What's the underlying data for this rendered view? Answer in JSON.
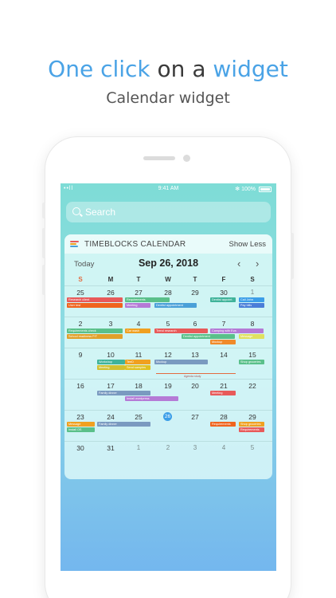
{
  "headline": {
    "part1": "One click",
    "part2": " on a ",
    "part3": "widget"
  },
  "subline": "Calendar widget",
  "status": {
    "signal": "••ll",
    "time": "9:41 AM",
    "battery": "✻ 100%"
  },
  "search": {
    "placeholder": "Search"
  },
  "widget": {
    "app_title": "TIMEBLOCKS CALENDAR",
    "show_less": "Show Less",
    "today": "Today",
    "month_title": "Sep 26, 2018",
    "prev": "‹",
    "next": "›",
    "weekdays": [
      "S",
      "M",
      "T",
      "W",
      "T",
      "F",
      "S"
    ],
    "weeks": [
      [
        "25",
        "26",
        "27",
        "28",
        "29",
        "30",
        "1"
      ],
      [
        "2",
        "3",
        "4",
        "5",
        "6",
        "7",
        "8"
      ],
      [
        "9",
        "10",
        "11",
        "12",
        "13",
        "14",
        "15"
      ],
      [
        "16",
        "17",
        "18",
        "19",
        "20",
        "21",
        "22"
      ],
      [
        "23",
        "24",
        "25",
        "26",
        "27",
        "28",
        "29"
      ],
      [
        "30",
        "31",
        "1",
        "2",
        "3",
        "4",
        "5"
      ]
    ],
    "events": [
      {
        "label": "Research client",
        "color": "#e85a5a"
      },
      {
        "label": "User test",
        "color": "#f0641e"
      },
      {
        "label": "Requirements",
        "color": "#5ac08a"
      },
      {
        "label": "Meeting",
        "color": "#b57ad6"
      },
      {
        "label": "Dentist appointment",
        "color": "#4aa0d8"
      },
      {
        "label": "Dentist appoint.",
        "color": "#3fb39a"
      },
      {
        "label": "Call John",
        "color": "#3b9ee8"
      },
      {
        "label": "Pay bills",
        "color": "#4a7ed8"
      },
      {
        "label": "Requirements check",
        "color": "#5ac08a"
      },
      {
        "label": "School readiness P/T",
        "color": "#e0a02a"
      },
      {
        "label": "Car wash",
        "color": "#f0a020"
      },
      {
        "label": "Trend research",
        "color": "#e85a5a"
      },
      {
        "label": "Dentist appointment",
        "color": "#5ac08a"
      },
      {
        "label": "Camping with Eva",
        "color": "#b57ad6"
      },
      {
        "label": "Mockup",
        "color": "#f08a2a"
      },
      {
        "label": "Message",
        "color": "#e0e060"
      },
      {
        "label": "Workshop",
        "color": "#3fb39a"
      },
      {
        "label": "Meeting",
        "color": "#d0c030"
      },
      {
        "label": "TeeD",
        "color": "#f0a020"
      },
      {
        "label": "Send samples",
        "color": "#e0c020"
      },
      {
        "label": "Mockup",
        "color": "#7a9ac0"
      },
      {
        "label": "Shop groceries",
        "color": "#5ac08a"
      },
      {
        "label": "Family dinner",
        "color": "#7a9ac0"
      },
      {
        "label": "Install wordpress",
        "color": "#b57ad6"
      },
      {
        "label": "Meeting",
        "color": "#e85a5a"
      },
      {
        "label": "Message",
        "color": "#f0a020"
      },
      {
        "label": "Install OS",
        "color": "#5ac08a"
      },
      {
        "label": "Family dinner",
        "color": "#7a9ac0"
      },
      {
        "label": "Requirements",
        "color": "#f0641e"
      },
      {
        "label": "Shop groceries",
        "color": "#f0a020"
      },
      {
        "label": "Requirements",
        "color": "#e85a5a"
      }
    ],
    "range_label": "Agenda study"
  },
  "colors": {
    "accent": "#4aa3e6",
    "today": "#3b9ee8"
  }
}
